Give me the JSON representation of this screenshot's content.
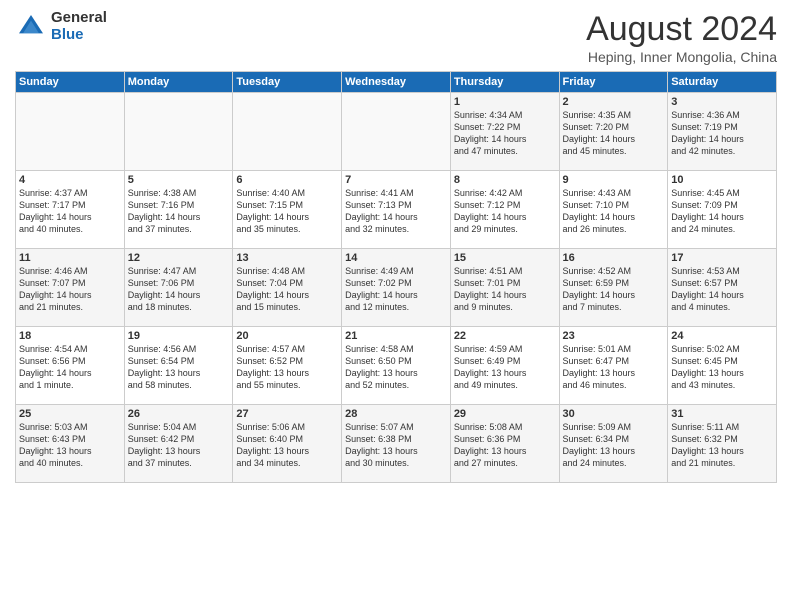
{
  "logo": {
    "general": "General",
    "blue": "Blue"
  },
  "header": {
    "month_year": "August 2024",
    "location": "Heping, Inner Mongolia, China"
  },
  "weekdays": [
    "Sunday",
    "Monday",
    "Tuesday",
    "Wednesday",
    "Thursday",
    "Friday",
    "Saturday"
  ],
  "weeks": [
    [
      {
        "day": "",
        "info": ""
      },
      {
        "day": "",
        "info": ""
      },
      {
        "day": "",
        "info": ""
      },
      {
        "day": "",
        "info": ""
      },
      {
        "day": "1",
        "info": "Sunrise: 4:34 AM\nSunset: 7:22 PM\nDaylight: 14 hours\nand 47 minutes."
      },
      {
        "day": "2",
        "info": "Sunrise: 4:35 AM\nSunset: 7:20 PM\nDaylight: 14 hours\nand 45 minutes."
      },
      {
        "day": "3",
        "info": "Sunrise: 4:36 AM\nSunset: 7:19 PM\nDaylight: 14 hours\nand 42 minutes."
      }
    ],
    [
      {
        "day": "4",
        "info": "Sunrise: 4:37 AM\nSunset: 7:17 PM\nDaylight: 14 hours\nand 40 minutes."
      },
      {
        "day": "5",
        "info": "Sunrise: 4:38 AM\nSunset: 7:16 PM\nDaylight: 14 hours\nand 37 minutes."
      },
      {
        "day": "6",
        "info": "Sunrise: 4:40 AM\nSunset: 7:15 PM\nDaylight: 14 hours\nand 35 minutes."
      },
      {
        "day": "7",
        "info": "Sunrise: 4:41 AM\nSunset: 7:13 PM\nDaylight: 14 hours\nand 32 minutes."
      },
      {
        "day": "8",
        "info": "Sunrise: 4:42 AM\nSunset: 7:12 PM\nDaylight: 14 hours\nand 29 minutes."
      },
      {
        "day": "9",
        "info": "Sunrise: 4:43 AM\nSunset: 7:10 PM\nDaylight: 14 hours\nand 26 minutes."
      },
      {
        "day": "10",
        "info": "Sunrise: 4:45 AM\nSunset: 7:09 PM\nDaylight: 14 hours\nand 24 minutes."
      }
    ],
    [
      {
        "day": "11",
        "info": "Sunrise: 4:46 AM\nSunset: 7:07 PM\nDaylight: 14 hours\nand 21 minutes."
      },
      {
        "day": "12",
        "info": "Sunrise: 4:47 AM\nSunset: 7:06 PM\nDaylight: 14 hours\nand 18 minutes."
      },
      {
        "day": "13",
        "info": "Sunrise: 4:48 AM\nSunset: 7:04 PM\nDaylight: 14 hours\nand 15 minutes."
      },
      {
        "day": "14",
        "info": "Sunrise: 4:49 AM\nSunset: 7:02 PM\nDaylight: 14 hours\nand 12 minutes."
      },
      {
        "day": "15",
        "info": "Sunrise: 4:51 AM\nSunset: 7:01 PM\nDaylight: 14 hours\nand 9 minutes."
      },
      {
        "day": "16",
        "info": "Sunrise: 4:52 AM\nSunset: 6:59 PM\nDaylight: 14 hours\nand 7 minutes."
      },
      {
        "day": "17",
        "info": "Sunrise: 4:53 AM\nSunset: 6:57 PM\nDaylight: 14 hours\nand 4 minutes."
      }
    ],
    [
      {
        "day": "18",
        "info": "Sunrise: 4:54 AM\nSunset: 6:56 PM\nDaylight: 14 hours\nand 1 minute."
      },
      {
        "day": "19",
        "info": "Sunrise: 4:56 AM\nSunset: 6:54 PM\nDaylight: 13 hours\nand 58 minutes."
      },
      {
        "day": "20",
        "info": "Sunrise: 4:57 AM\nSunset: 6:52 PM\nDaylight: 13 hours\nand 55 minutes."
      },
      {
        "day": "21",
        "info": "Sunrise: 4:58 AM\nSunset: 6:50 PM\nDaylight: 13 hours\nand 52 minutes."
      },
      {
        "day": "22",
        "info": "Sunrise: 4:59 AM\nSunset: 6:49 PM\nDaylight: 13 hours\nand 49 minutes."
      },
      {
        "day": "23",
        "info": "Sunrise: 5:01 AM\nSunset: 6:47 PM\nDaylight: 13 hours\nand 46 minutes."
      },
      {
        "day": "24",
        "info": "Sunrise: 5:02 AM\nSunset: 6:45 PM\nDaylight: 13 hours\nand 43 minutes."
      }
    ],
    [
      {
        "day": "25",
        "info": "Sunrise: 5:03 AM\nSunset: 6:43 PM\nDaylight: 13 hours\nand 40 minutes."
      },
      {
        "day": "26",
        "info": "Sunrise: 5:04 AM\nSunset: 6:42 PM\nDaylight: 13 hours\nand 37 minutes."
      },
      {
        "day": "27",
        "info": "Sunrise: 5:06 AM\nSunset: 6:40 PM\nDaylight: 13 hours\nand 34 minutes."
      },
      {
        "day": "28",
        "info": "Sunrise: 5:07 AM\nSunset: 6:38 PM\nDaylight: 13 hours\nand 30 minutes."
      },
      {
        "day": "29",
        "info": "Sunrise: 5:08 AM\nSunset: 6:36 PM\nDaylight: 13 hours\nand 27 minutes."
      },
      {
        "day": "30",
        "info": "Sunrise: 5:09 AM\nSunset: 6:34 PM\nDaylight: 13 hours\nand 24 minutes."
      },
      {
        "day": "31",
        "info": "Sunrise: 5:11 AM\nSunset: 6:32 PM\nDaylight: 13 hours\nand 21 minutes."
      }
    ]
  ]
}
